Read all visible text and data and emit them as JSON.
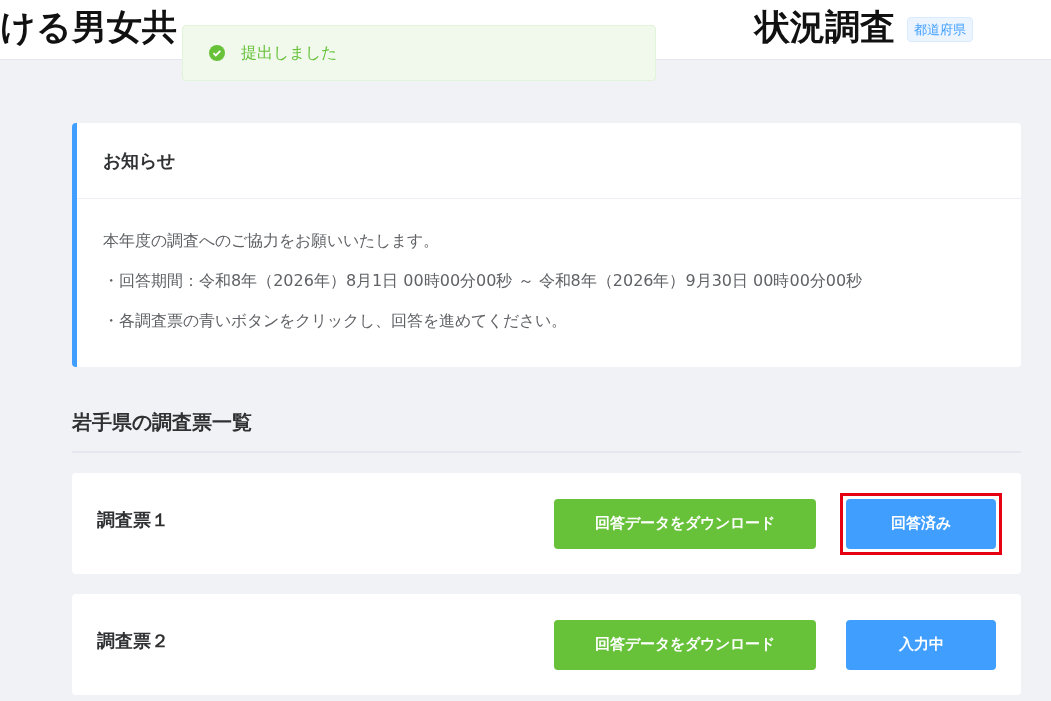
{
  "header": {
    "title_visible_start": "ける男女共",
    "title_visible_end": "状況調査",
    "badge": "都道府県"
  },
  "toast": {
    "kind": "success",
    "message": "提出しました"
  },
  "notice": {
    "title": "お知らせ",
    "lines": [
      "本年度の調査へのご協力をお願いいたします。",
      "・回答期間：令和8年（2026年）8月1日 00時00分00秒 ～ 令和8年（2026年）9月30日 00時00分00秒",
      "・各調査票の青いボタンをクリックし、回答を進めてください。"
    ]
  },
  "section_title": "岩手県の調査票一覧",
  "surveys": [
    {
      "name": "調査票１",
      "download_button": "回答データをダウンロード",
      "status_button": "回答済み",
      "highlighted": true
    },
    {
      "name": "調査票２",
      "download_button": "回答データをダウンロード",
      "status_button": "入力中",
      "highlighted": false
    }
  ]
}
